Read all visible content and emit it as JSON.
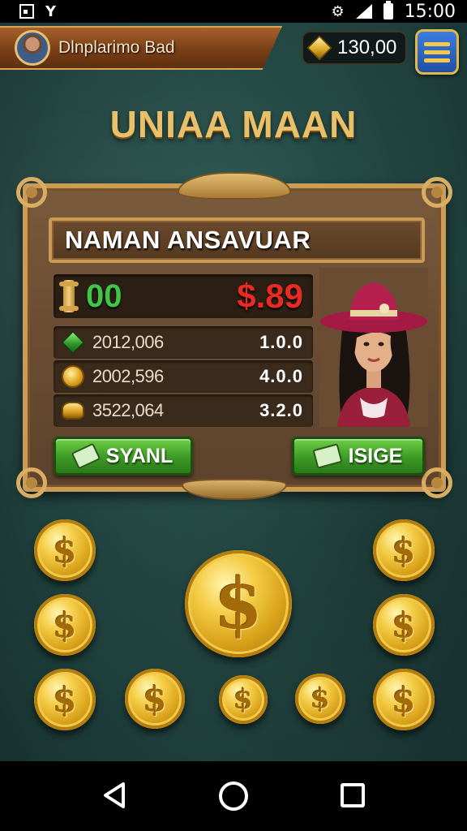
{
  "status_bar": {
    "time": "15:00",
    "left_icons": [
      "notification-box-icon",
      "y-app-icon"
    ],
    "right_icons": [
      "wifi-gear-icon",
      "signal-icon",
      "battery-icon"
    ]
  },
  "top_bar": {
    "player_name": "Dlnplarimo Bad",
    "currency_value": "130,00",
    "currency_icon": "gold-gem-icon",
    "menu_icon": "hamburger-menu-icon"
  },
  "title": "UNIAA MAAN",
  "panel": {
    "header": "NAMAN ANSAVUAR",
    "score_left": "00",
    "score_right": "$.89",
    "stats": [
      {
        "icon": "green-gem-icon",
        "label": "2012,006",
        "value": "1.0.0"
      },
      {
        "icon": "coin-stack-icon",
        "label": "2002,596",
        "value": "4.0.0"
      },
      {
        "icon": "gold-bar-icon",
        "label": "3522,064",
        "value": "3.2.0"
      }
    ],
    "button_left": "SYANL",
    "button_right": "ISIGE"
  },
  "coin_symbol": "$",
  "colors": {
    "background": "#244844",
    "gold_text": "#e8c06a",
    "score_green": "#3fc548",
    "score_red": "#e82a22",
    "button_green": "#3c9a26",
    "menu_blue": "#2f6fd0"
  }
}
